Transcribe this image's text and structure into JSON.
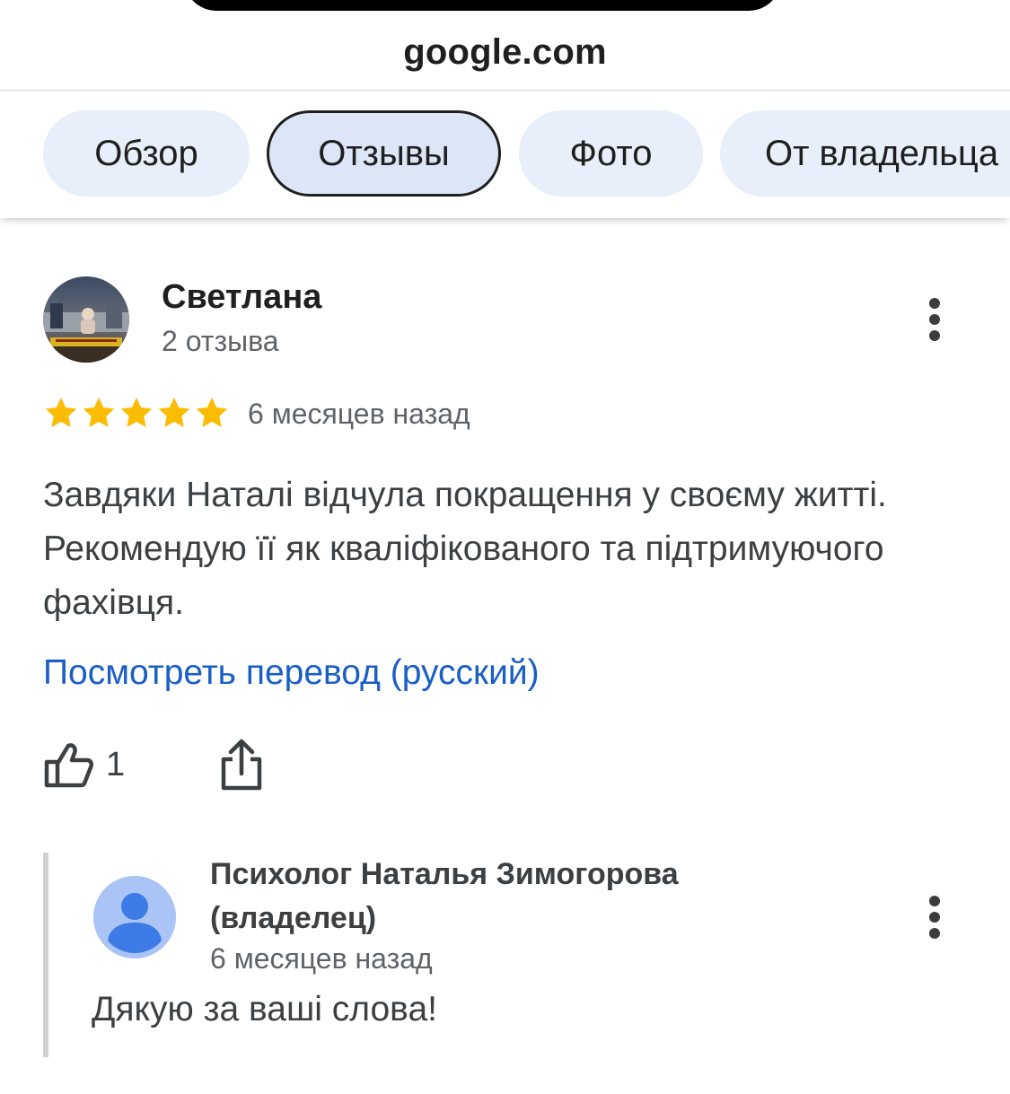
{
  "browser": {
    "url": "google.com"
  },
  "tabs": [
    {
      "label": "Обзор",
      "active": false
    },
    {
      "label": "Отзывы",
      "active": true
    },
    {
      "label": "Фото",
      "active": false
    },
    {
      "label": "От владельца",
      "active": false
    }
  ],
  "review": {
    "author": "Светлана",
    "author_meta": "2 отзыва",
    "rating": 5,
    "rating_max": 5,
    "date": "6 месяцев назад",
    "text": "Завдяки Наталі відчула покращення у своєму житті. Рекомендую її як кваліфікованого та підтримуючого фахівця.",
    "translate_link": "Посмотреть перевод (русский)",
    "likes": "1"
  },
  "owner_reply": {
    "author": "Психолог Наталья Зимогорова (владелец)",
    "date": "6 месяцев назад",
    "text": "Дякую за ваші слова!"
  },
  "colors": {
    "tab_bg": "#e8effa",
    "star": "#fbbc04",
    "link": "#1a5fc4",
    "owner_avatar_bg": "#a9c4f5",
    "owner_avatar_fg": "#3d7be6"
  }
}
